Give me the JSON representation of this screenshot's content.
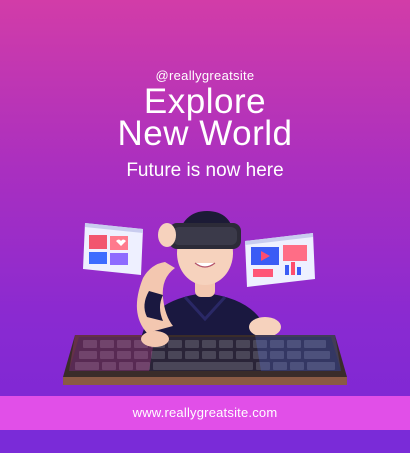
{
  "poster": {
    "handle": "@reallygreatsite",
    "title_line1": "Explore",
    "title_line2": "New World",
    "subtitle": "Future is now here",
    "footer_url": "www.reallygreatsite.com"
  },
  "colors": {
    "gradient_top": "#d23ca8",
    "gradient_bottom": "#7a27d6",
    "footer_band": "#e14fe8",
    "bottom_strip": "#7a2bd8"
  },
  "illustration": {
    "subject": "vr-user-at-keyboard",
    "icons": [
      "vr-headset-icon",
      "keyboard-icon",
      "floating-screen-icon",
      "video-play-icon",
      "heart-icon"
    ]
  }
}
